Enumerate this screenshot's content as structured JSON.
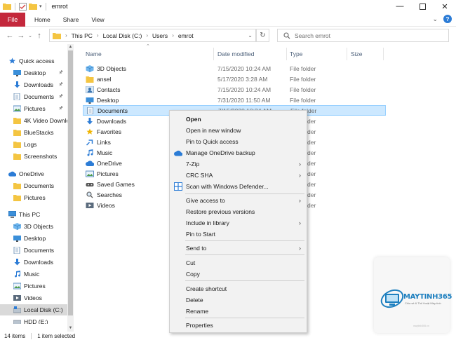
{
  "window": {
    "title": "emrot"
  },
  "ribbon": {
    "file_label": "File",
    "tabs": [
      "Home",
      "Share",
      "View"
    ]
  },
  "address": {
    "breadcrumbs": [
      "This PC",
      "Local Disk (C:)",
      "Users",
      "emrot"
    ],
    "search_placeholder": "Search emrot"
  },
  "columns": {
    "name": "Name",
    "date_modified": "Date modified",
    "type": "Type",
    "size": "Size"
  },
  "navigation": {
    "quick_access": {
      "label": "Quick access"
    },
    "items": [
      {
        "label": "Desktop",
        "icon": "desktop-icon"
      },
      {
        "label": "Downloads",
        "icon": "download-icon"
      },
      {
        "label": "Documents",
        "icon": "documents-icon"
      },
      {
        "label": "Pictures",
        "icon": "pictures-icon"
      },
      {
        "label": "4K Video Downlo",
        "icon": "folder-icon"
      },
      {
        "label": "BlueStacks",
        "icon": "folder-icon"
      },
      {
        "label": "Logs",
        "icon": "folder-icon"
      },
      {
        "label": "Screenshots",
        "icon": "folder-icon"
      }
    ],
    "onedrive": {
      "label": "OneDrive",
      "items": [
        "Documents",
        "Pictures"
      ]
    },
    "this_pc": {
      "label": "This PC",
      "items": [
        "3D Objects",
        "Desktop",
        "Documents",
        "Downloads",
        "Music",
        "Pictures",
        "Videos",
        "Local Disk (C:)",
        "HDD (E:)"
      ]
    }
  },
  "files": [
    {
      "name": "3D Objects",
      "date": "7/15/2020 10:24 AM",
      "type": "File folder",
      "icon": "3d-objects-icon"
    },
    {
      "name": "ansel",
      "date": "5/17/2020 3:28 AM",
      "type": "File folder",
      "icon": "folder-icon"
    },
    {
      "name": "Contacts",
      "date": "7/15/2020 10:24 AM",
      "type": "File folder",
      "icon": "contacts-icon"
    },
    {
      "name": "Desktop",
      "date": "7/31/2020 11:50 AM",
      "type": "File folder",
      "icon": "desktop-icon"
    },
    {
      "name": "Documents",
      "date": "7/15/2020 10:24 AM",
      "type": "File folder",
      "icon": "documents-icon",
      "selected": true
    },
    {
      "name": "Downloads",
      "date": "",
      "type": "File folder",
      "icon": "download-icon"
    },
    {
      "name": "Favorites",
      "date": "",
      "type": "File folder",
      "icon": "favorites-icon"
    },
    {
      "name": "Links",
      "date": "",
      "type": "File folder",
      "icon": "links-icon"
    },
    {
      "name": "Music",
      "date": "",
      "type": "File folder",
      "icon": "music-icon"
    },
    {
      "name": "OneDrive",
      "date": "",
      "type": "File folder",
      "icon": "onedrive-icon"
    },
    {
      "name": "Pictures",
      "date": "",
      "type": "File folder",
      "icon": "pictures-icon"
    },
    {
      "name": "Saved Games",
      "date": "",
      "type": "File folder",
      "icon": "saved-games-icon"
    },
    {
      "name": "Searches",
      "date": "",
      "type": "File folder",
      "icon": "searches-icon"
    },
    {
      "name": "Videos",
      "date": "",
      "type": "File folder",
      "icon": "videos-icon"
    }
  ],
  "context_menu": {
    "open": "Open",
    "open_new_window": "Open in new window",
    "pin_quick_access": "Pin to Quick access",
    "manage_onedrive": "Manage OneDrive backup",
    "seven_zip": "7-Zip",
    "crc_sha": "CRC SHA",
    "scan_defender": "Scan with Windows Defender...",
    "give_access": "Give access to",
    "restore_versions": "Restore previous versions",
    "include_library": "Include in library",
    "pin_start": "Pin to Start",
    "send_to": "Send to",
    "cut": "Cut",
    "copy": "Copy",
    "create_shortcut": "Create shortcut",
    "delete": "Delete",
    "rename": "Rename",
    "properties": "Properties"
  },
  "status": {
    "item_count": "14 items",
    "selected": "1 item selected"
  },
  "watermark": {
    "brand": "MAYTINH365",
    "tagline": "Chia sẻ & Thủ thuật Máy tính",
    "url": "maytinh365.vn"
  },
  "colors": {
    "accent": "#c4283c",
    "selection": "#cce8ff",
    "folder": "#f4c542",
    "blue": "#2c7cd6"
  }
}
